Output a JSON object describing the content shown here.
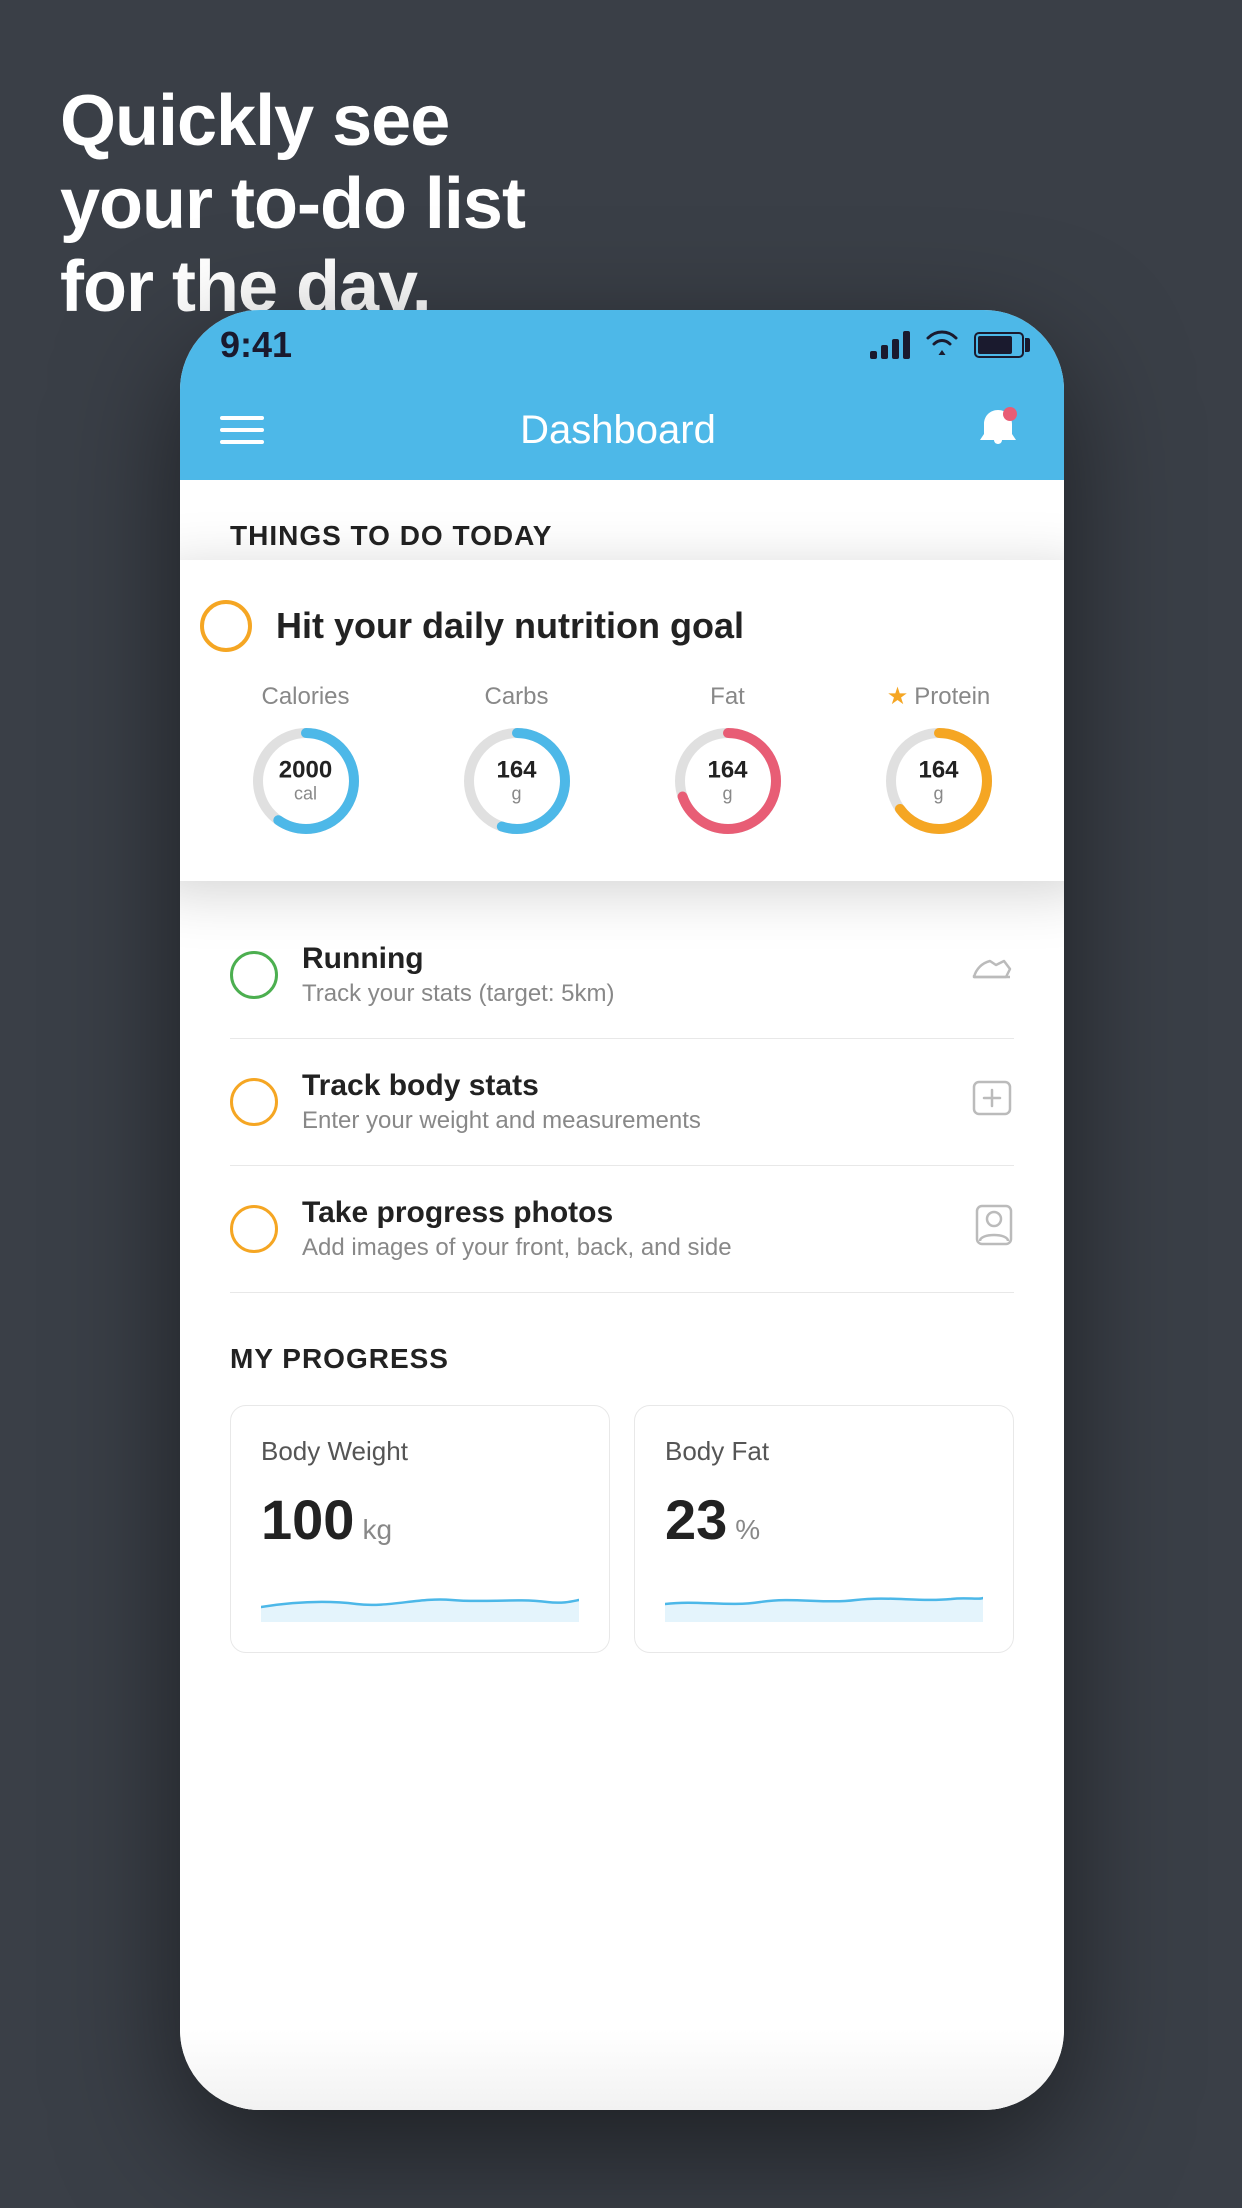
{
  "background": {
    "color": "#3a3f47"
  },
  "headline": {
    "line1": "Quickly see",
    "line2": "your to-do list",
    "line3": "for the day."
  },
  "phone": {
    "status_bar": {
      "time": "9:41"
    },
    "header": {
      "title": "Dashboard"
    },
    "things_to_do": {
      "section_label": "THINGS TO DO TODAY"
    },
    "floating_card": {
      "check_label": "circle-check",
      "title": "Hit your daily nutrition goal",
      "nutrients": [
        {
          "label": "Calories",
          "value": "2000",
          "unit": "cal",
          "color": "#4db8e8",
          "percent": 60
        },
        {
          "label": "Carbs",
          "value": "164",
          "unit": "g",
          "color": "#4db8e8",
          "percent": 55
        },
        {
          "label": "Fat",
          "value": "164",
          "unit": "g",
          "color": "#e85d75",
          "percent": 70
        },
        {
          "label": "Protein",
          "value": "164",
          "unit": "g",
          "color": "#f5a623",
          "starred": true,
          "percent": 65
        }
      ]
    },
    "todo_items": [
      {
        "title": "Running",
        "subtitle": "Track your stats (target: 5km)",
        "circle_color": "green",
        "icon": "shoe"
      },
      {
        "title": "Track body stats",
        "subtitle": "Enter your weight and measurements",
        "circle_color": "yellow",
        "icon": "scale"
      },
      {
        "title": "Take progress photos",
        "subtitle": "Add images of your front, back, and side",
        "circle_color": "yellow",
        "icon": "portrait"
      }
    ],
    "progress": {
      "section_label": "MY PROGRESS",
      "cards": [
        {
          "title": "Body Weight",
          "value": "100",
          "unit": "kg"
        },
        {
          "title": "Body Fat",
          "value": "23",
          "unit": "%"
        }
      ]
    }
  }
}
